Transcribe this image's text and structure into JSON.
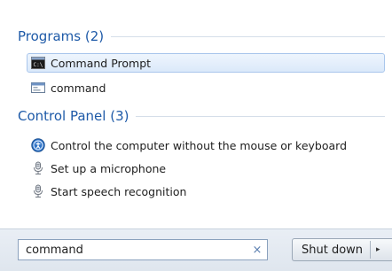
{
  "groups": [
    {
      "title": "Programs (2)",
      "items": [
        {
          "label": "Command Prompt",
          "icon": "command-prompt-icon",
          "selected": true
        },
        {
          "label": "command",
          "icon": "window-icon",
          "selected": false
        }
      ]
    },
    {
      "title": "Control Panel (3)",
      "items": [
        {
          "label": "Control the computer without the mouse or keyboard",
          "icon": "ease-of-access-icon",
          "selected": false
        },
        {
          "label": "Set up a microphone",
          "icon": "microphone-icon",
          "selected": false
        },
        {
          "label": "Start speech recognition",
          "icon": "microphone-icon",
          "selected": false
        }
      ]
    }
  ],
  "search": {
    "value": "command",
    "clear_glyph": "×"
  },
  "shutdown": {
    "label": "Shut down",
    "arrow_glyph": "▸"
  }
}
